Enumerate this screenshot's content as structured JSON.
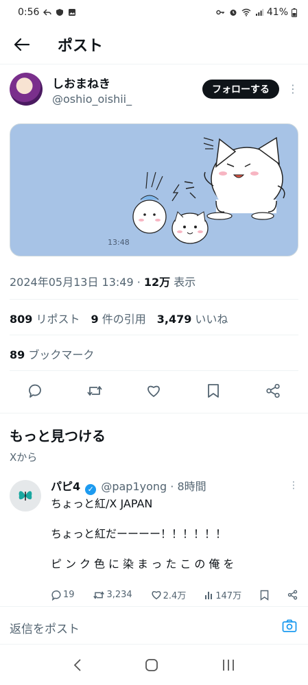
{
  "status_bar": {
    "time": "0:56",
    "battery": "41%"
  },
  "header": {
    "title": "ポスト"
  },
  "author": {
    "name": "しおまねき",
    "handle": "@oshio_oishii_",
    "follow_label": "フォローする"
  },
  "media": {
    "timestamp": "13:48"
  },
  "post_meta": {
    "datetime": "2024年05月13日 13:49",
    "separator": " · ",
    "views": "12万",
    "views_label": " 表示"
  },
  "stats": {
    "reposts": "809",
    "reposts_label": " リポスト",
    "quotes": "9",
    "quotes_label": " 件の引用",
    "likes": "3,479",
    "likes_label": " いいね",
    "bookmarks": "89",
    "bookmarks_label": " ブックマーク"
  },
  "discover": {
    "title": "もっと見つける",
    "subtitle": "Xから"
  },
  "recommended": {
    "name": "パピ4",
    "handle": "@pap1yong",
    "time": " · 8時間",
    "lines": [
      "ちょっと紅/X JAPAN",
      "ちょっと紅だーーーー！！！！！！",
      "ピンク色に染まったこの俺を"
    ],
    "replies": "19",
    "reposts": "3,234",
    "likes": "2.4万",
    "views": "147万"
  },
  "reply": {
    "placeholder": "返信をポスト"
  },
  "colors": {
    "accent": "#1d9bf0",
    "text": "#0f1419",
    "secondary": "#536471",
    "media_bg": "#a7c3e6"
  }
}
